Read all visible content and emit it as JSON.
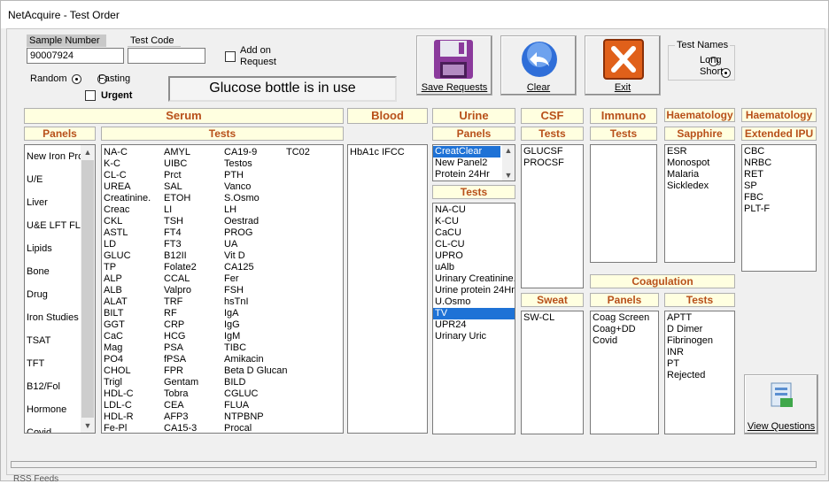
{
  "window": {
    "title": "NetAcquire - Test Order"
  },
  "sample": {
    "label": "Sample Number",
    "value": "90007924"
  },
  "test_code": {
    "label": "Test Code",
    "value": ""
  },
  "add_on": {
    "label_line1": "Add on",
    "label_line2": "Request"
  },
  "random": {
    "label": "Random"
  },
  "fasting": {
    "label": "Fasting"
  },
  "urgent": {
    "label": "Urgent"
  },
  "banner": "Glucose bottle is in use",
  "buttons": {
    "save": "Save Requests",
    "clear": "Clear",
    "exit": "Exit",
    "questions": "View Questions"
  },
  "test_names": {
    "title": "Test Names",
    "long": "Long",
    "short": "Short"
  },
  "serum": {
    "header": "Serum",
    "panels_header": "Panels",
    "tests_header": "Tests",
    "panels": [
      "New Iron Pro",
      "U/E",
      "Liver",
      "U&E LFT FLI",
      "Lipids",
      "Bone",
      "Drug",
      "Iron Studies",
      "TSAT",
      "TFT",
      "B12/Fol",
      "Hormone",
      "Covid"
    ],
    "tests_col1": [
      "NA-C",
      "K-C",
      "CL-C",
      "UREA",
      "Creatinine.",
      "Creac",
      "CKL",
      "ASTL",
      "LD",
      "GLUC",
      "TP",
      "ALP",
      "ALB",
      "ALAT",
      "BILT",
      "GGT",
      "CaC",
      "Mag",
      "PO4",
      "CHOL",
      "Trigl",
      "HDL-C",
      "LDL-C",
      "HDL-R",
      "Fe-Pl"
    ],
    "tests_col2": [
      "AMYL",
      "UIBC",
      "Prct",
      "SAL",
      "ETOH",
      "LI",
      "TSH",
      "FT4",
      "FT3",
      "B12II",
      "Folate2",
      "CCAL",
      "Valpro",
      "TRF",
      "RF",
      "CRP",
      "HCG",
      "PSA",
      "fPSA",
      "FPR",
      "Gentam",
      "Tobra",
      "CEA",
      "AFP3",
      "CA15-3"
    ],
    "tests_col3": [
      "CA19-9",
      "Testos",
      "PTH",
      "Vanco",
      "S.Osmo",
      "LH",
      "Oestrad",
      "PROG",
      "UA",
      "Vit D",
      "CA125",
      "Fer",
      "FSH",
      "hsTnI",
      "IgA",
      "IgG",
      "IgM",
      "TIBC",
      "Amikacin",
      "Beta D Glucan",
      "BILD",
      "CGLUC",
      "FLUA",
      "NTPBNP",
      "Procal"
    ],
    "tests_col4": [
      "TC02"
    ]
  },
  "blood": {
    "header": "Blood",
    "tests": [
      "HbA1c IFCC"
    ]
  },
  "urine": {
    "header": "Urine",
    "panels_header": "Panels",
    "tests_header": "Tests",
    "panels": [
      "CreatClear",
      "New Panel2",
      "Protein 24Hr"
    ],
    "tests": [
      "NA-CU",
      "K-CU",
      "CaCU",
      "CL-CU",
      "UPRO",
      "uAlb",
      "Urinary Creatinine.",
      "Urine protein 24Hr",
      "U.Osmo",
      "TV",
      "UPR24",
      "Urinary Uric"
    ]
  },
  "csf": {
    "header": "CSF",
    "tests_header": "Tests",
    "tests": [
      "GLUCSF",
      "PROCSF"
    ]
  },
  "sweat": {
    "header": "Sweat",
    "tests": [
      "SW-CL"
    ]
  },
  "immuno": {
    "header": "Immuno",
    "tests_header": "Tests",
    "tests": []
  },
  "coag": {
    "header": "Coagulation",
    "panels_header": "Panels",
    "tests_header": "Tests",
    "panels": [
      "Coag Screen",
      "Coag+DD",
      "Covid"
    ],
    "tests": [
      "APTT",
      "D Dimer",
      "Fibrinogen",
      "INR",
      "PT",
      "Rejected"
    ]
  },
  "haem_sapphire": {
    "header": "Haematology",
    "sub": "Sapphire",
    "tests": [
      "ESR",
      "Monospot",
      "Malaria",
      "Sickledex"
    ]
  },
  "haem_ipu": {
    "header": "Haematology",
    "sub": "Extended IPU",
    "tests": [
      "CBC",
      "NRBC",
      "RET",
      "SP",
      "FBC",
      "PLT-F"
    ]
  },
  "taskbar_peek": "RSS Feeds",
  "colors": {
    "header_text": "#b8501a",
    "header_bg": "#ffffe0",
    "selection": "#1e72d6"
  }
}
